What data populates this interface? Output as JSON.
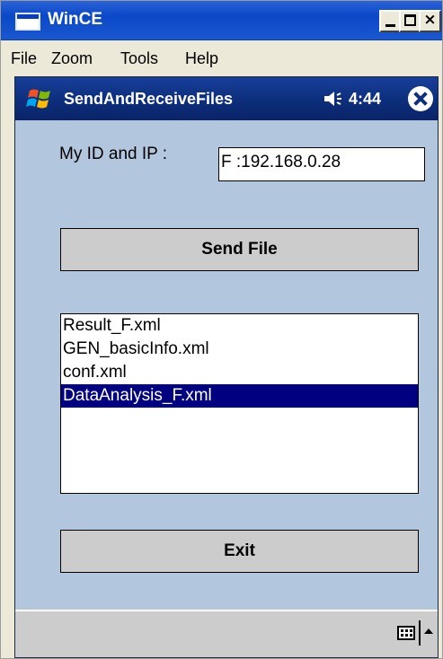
{
  "window": {
    "title": "WinCE",
    "minimize_label": "_",
    "close_label": "×"
  },
  "menu": [
    {
      "label": "File"
    },
    {
      "label": "Zoom"
    },
    {
      "label": "Tools"
    },
    {
      "label": "Help"
    }
  ],
  "device": {
    "app_title": "SendAndReceiveFiles",
    "time": "4:44",
    "id_label": "My ID and IP :",
    "id_value": "F :192.168.0.28",
    "send_button": "Send File",
    "exit_button": "Exit",
    "files": [
      {
        "name": "Result_F.xml",
        "selected": false
      },
      {
        "name": "GEN_basicInfo.xml",
        "selected": false
      },
      {
        "name": "conf.xml",
        "selected": false
      },
      {
        "name": "DataAnalysis_F.xml",
        "selected": true
      }
    ]
  },
  "colors": {
    "titlebar": "#0a48c8",
    "device_bg": "#B2C6DE",
    "selection": "#000080",
    "button": "#CCCCCC"
  },
  "icons": [
    "window-app-icon",
    "minimize-icon",
    "maximize-icon",
    "close-icon",
    "windows-start-icon",
    "speaker-icon",
    "ok-close-icon",
    "keyboard-icon",
    "sip-arrow-icon"
  ]
}
